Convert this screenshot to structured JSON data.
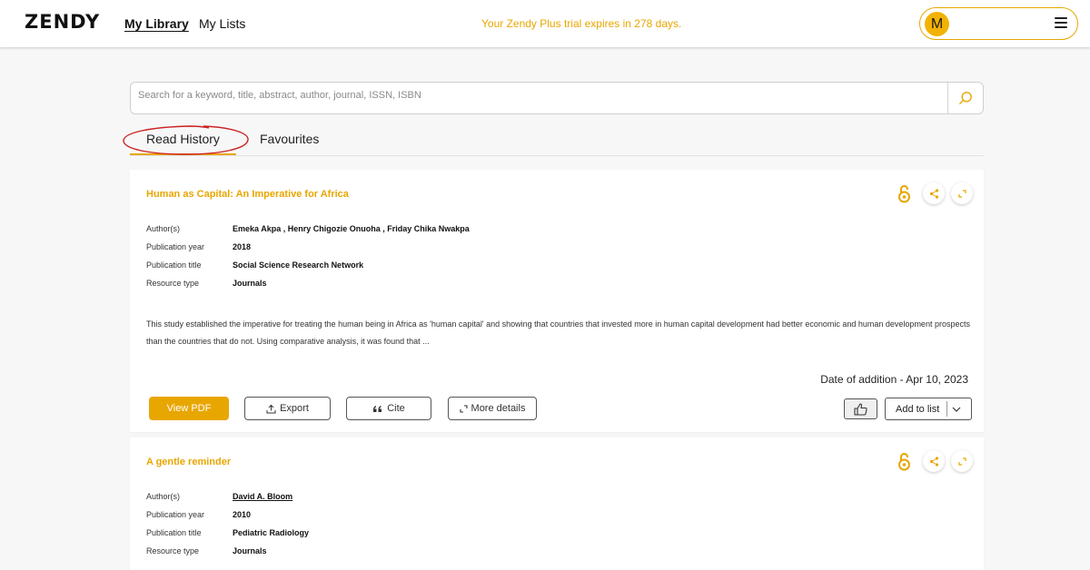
{
  "header": {
    "logo": "ZENDY",
    "nav": [
      "My Library",
      "My Lists"
    ],
    "trial_message": "Your Zendy Plus trial expires in 278 days.",
    "avatar_initial": "M",
    "accent_color": "#e8a600"
  },
  "search": {
    "placeholder": "Search for a keyword, title, abstract, author, journal, ISSN, ISBN",
    "value": ""
  },
  "tabs": [
    {
      "label": "Read History",
      "active": true,
      "circled_annotation": true
    },
    {
      "label": "Favourites",
      "active": false
    }
  ],
  "labels": {
    "authors": "Author(s)",
    "year": "Publication year",
    "pub_title": "Publication title",
    "resource": "Resource type"
  },
  "cards": [
    {
      "title": "Human as Capital: An Imperative for Africa",
      "authors": "Emeka Akpa , Henry Chigozie Onuoha , Friday Chika Nwakpa",
      "year": "2018",
      "publication": "Social Science Research Network",
      "resource_type": "Journals",
      "abstract": "This study established the imperative for treating the human being in Africa as 'human capital' and showing that countries that invested more in human capital development had better economic and human development prospects than the countries that do not. Using comparative analysis, it was found that ...",
      "date_added": "Date of addition - Apr 10, 2023",
      "icons": [
        "open-access-icon",
        "share-icon",
        "expand-icon"
      ]
    },
    {
      "title": "A gentle reminder",
      "authors": "David A. Bloom",
      "year": "2010",
      "publication": "Pediatric Radiology",
      "resource_type": "Journals",
      "icons": [
        "open-access-icon",
        "share-icon",
        "expand-icon"
      ]
    }
  ],
  "actions": {
    "view_pdf": "View PDF",
    "export": "Export",
    "cite": "Cite",
    "more_details": "More details",
    "add_to_list": "Add to list"
  }
}
